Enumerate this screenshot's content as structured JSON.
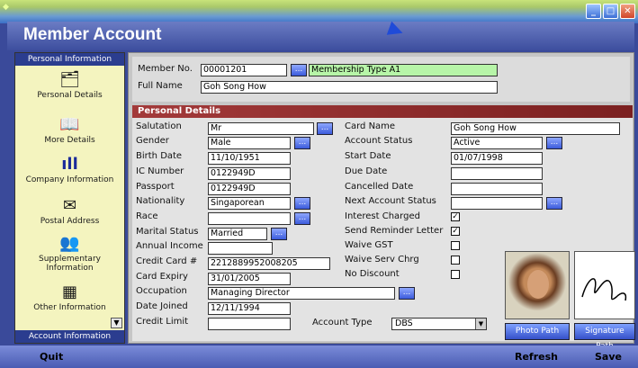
{
  "window": {
    "title": "Member Account",
    "controls": {
      "minimize_icon": "minimize-icon",
      "maximize_icon": "maximize-icon",
      "close_icon": "close-icon"
    }
  },
  "sidebar": {
    "header": "Personal Information",
    "footer": "Account Information",
    "items": [
      {
        "label": "Personal Details",
        "icon": "id-card-icon"
      },
      {
        "label": "More Details",
        "icon": "book-icon"
      },
      {
        "label": "Company Information",
        "icon": "bar-chart-icon"
      },
      {
        "label": "Postal Address",
        "icon": "envelope-icon"
      },
      {
        "label": "Supplementary Information",
        "icon": "people-icon"
      },
      {
        "label": "Other Information",
        "icon": "calculator-icon"
      }
    ]
  },
  "member": {
    "member_no_label": "Member No.",
    "member_no": "00001201",
    "membership_type": "Membership Type A1",
    "full_name_label": "Full Name",
    "full_name": "Goh Song How"
  },
  "details": {
    "section_title": "Personal Details",
    "left": {
      "salutation_label": "Salutation",
      "salutation": "Mr",
      "gender_label": "Gender",
      "gender": "Male",
      "birth_date_label": "Birth Date",
      "birth_date": "11/10/1951",
      "ic_number_label": "IC Number",
      "ic_number": "0122949D",
      "passport_label": "Passport",
      "passport": "0122949D",
      "nationality_label": "Nationality",
      "nationality": "Singaporean",
      "race_label": "Race",
      "race": "",
      "marital_status_label": "Marital Status",
      "marital_status": "Married",
      "annual_income_label": "Annual Income",
      "annual_income": "",
      "credit_card_label": "Credit Card #",
      "credit_card": "2212889952008205",
      "card_expiry_label": "Card Expiry",
      "card_expiry": "31/01/2005",
      "occupation_label": "Occupation",
      "occupation": "Managing Director",
      "date_joined_label": "Date Joined",
      "date_joined": "12/11/1994",
      "credit_limit_label": "Credit Limit",
      "credit_limit": ""
    },
    "right": {
      "card_name_label": "Card Name",
      "card_name": "Goh Song How",
      "account_status_label": "Account Status",
      "account_status": "Active",
      "start_date_label": "Start Date",
      "start_date": "01/07/1998",
      "due_date_label": "Due Date",
      "due_date": "",
      "cancelled_date_label": "Cancelled Date",
      "cancelled_date": "",
      "next_account_status_label": "Next Account Status",
      "next_account_status": "",
      "interest_charged_label": "Interest Charged",
      "interest_charged": true,
      "send_reminder_label": "Send Reminder Letter",
      "send_reminder": true,
      "waive_gst_label": "Waive GST",
      "waive_gst": false,
      "waive_serv_label": "Waive Serv Chrg",
      "waive_serv": false,
      "no_discount_label": "No Discount",
      "no_discount": false
    },
    "account_type_label": "Account Type",
    "account_type": "DBS",
    "photo_path_label": "Photo Path",
    "signature_path_label": "Signature Path",
    "lookup_label": "..."
  },
  "footer": {
    "quit": "Quit",
    "refresh": "Refresh",
    "save": "Save"
  },
  "colors": {
    "accent": "#3d4e9e",
    "section_bar": "#a33a3a",
    "membership_field": "#b7f5a8",
    "sidebar_bg": "#f4f4bf"
  }
}
